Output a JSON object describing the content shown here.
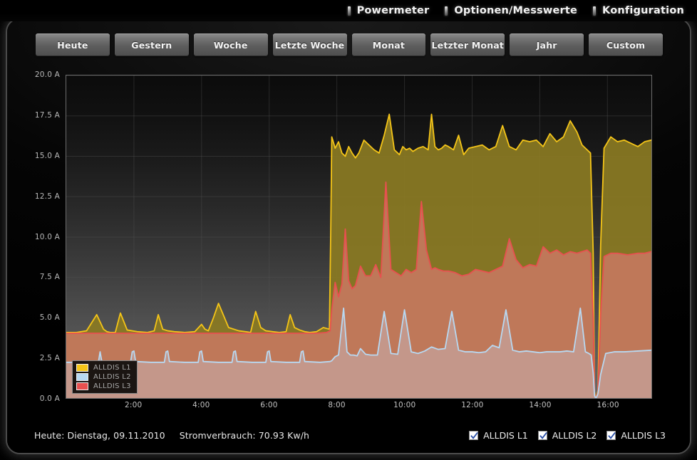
{
  "topnav": {
    "items": [
      {
        "label": "Powermeter",
        "icon": "bar-bullet-icon"
      },
      {
        "label": "Optionen/Messwerte",
        "icon": "bar-bullet-icon"
      },
      {
        "label": "Konfiguration",
        "icon": "bar-bullet-icon"
      }
    ]
  },
  "range_buttons": [
    {
      "label": "Heute",
      "active": true
    },
    {
      "label": "Gestern",
      "active": false
    },
    {
      "label": "Woche",
      "active": false
    },
    {
      "label": "Letzte Woche",
      "active": false
    },
    {
      "label": "Monat",
      "active": false
    },
    {
      "label": "Letzter Monat",
      "active": false
    },
    {
      "label": "Jahr",
      "active": false
    },
    {
      "label": "Custom",
      "active": false
    }
  ],
  "footer": {
    "date_text": "Heute: Dienstag, 09.11.2010",
    "consumption_text": "Stromverbrauch: 70.93 Kw/h",
    "checkboxes": [
      {
        "label": "ALLDIS L1",
        "checked": true
      },
      {
        "label": "ALLDIS L2",
        "checked": true
      },
      {
        "label": "ALLDIS L3",
        "checked": true
      }
    ]
  },
  "colors": {
    "l1": "#f5c518",
    "l2": "#b8d9f2",
    "l3": "#e8504f",
    "l1_fill": "#8a7a22",
    "l2_fill": "#c49a8e",
    "l3_fill": "#c4795e",
    "plot_border": "#6c6c6c",
    "grid": "#555555"
  },
  "chart_data": {
    "type": "area",
    "title": "",
    "xlabel": "",
    "ylabel": "A",
    "xlim": [
      0,
      17.3
    ],
    "ylim": [
      0,
      20
    ],
    "grid": true,
    "legend_position": "bottom-left",
    "y_ticks": [
      "0.0 A",
      "2.5 A",
      "5.0 A",
      "7.5 A",
      "10.0 A",
      "12.5 A",
      "15.0 A",
      "17.5 A",
      "20.0 A"
    ],
    "y_tick_values": [
      0,
      2.5,
      5,
      7.5,
      10,
      12.5,
      15,
      17.5,
      20
    ],
    "x_ticks": [
      "2:00",
      "4:00",
      "6:00",
      "8:00",
      "10:00",
      "12:00",
      "14:00",
      "16:00"
    ],
    "x_tick_values": [
      2,
      4,
      6,
      8,
      10,
      12,
      14,
      16
    ],
    "series": [
      {
        "name": "ALLDIS L1",
        "color": "#f5c518",
        "fill": "#8a7a22",
        "x": [
          0.0,
          0.3,
          0.6,
          0.9,
          1.1,
          1.2,
          1.3,
          1.45,
          1.6,
          1.8,
          2.1,
          2.4,
          2.6,
          2.72,
          2.85,
          3.0,
          3.2,
          3.5,
          3.8,
          4.0,
          4.1,
          4.2,
          4.35,
          4.5,
          4.8,
          5.1,
          5.3,
          5.45,
          5.6,
          5.75,
          5.9,
          6.1,
          6.3,
          6.5,
          6.62,
          6.75,
          6.9,
          7.05,
          7.2,
          7.4,
          7.6,
          7.78,
          7.82,
          7.85,
          7.88,
          7.95,
          8.05,
          8.15,
          8.25,
          8.35,
          8.45,
          8.55,
          8.65,
          8.8,
          8.95,
          9.1,
          9.25,
          9.4,
          9.55,
          9.7,
          9.85,
          9.95,
          10.05,
          10.15,
          10.25,
          10.4,
          10.55,
          10.7,
          10.8,
          10.9,
          11.0,
          11.1,
          11.2,
          11.3,
          11.45,
          11.6,
          11.75,
          11.9,
          12.1,
          12.3,
          12.5,
          12.7,
          12.9,
          13.1,
          13.3,
          13.5,
          13.7,
          13.9,
          14.1,
          14.3,
          14.5,
          14.7,
          14.9,
          15.1,
          15.25,
          15.4,
          15.5,
          15.58,
          15.62,
          15.66,
          15.72,
          15.8,
          15.9,
          16.1,
          16.3,
          16.5,
          16.7,
          16.9,
          17.1,
          17.3
        ],
        "y": [
          4.1,
          4.1,
          4.2,
          5.2,
          4.3,
          4.15,
          4.1,
          4.1,
          5.3,
          4.25,
          4.15,
          4.1,
          4.2,
          5.2,
          4.3,
          4.2,
          4.15,
          4.1,
          4.15,
          4.6,
          4.3,
          4.2,
          5.0,
          5.9,
          4.4,
          4.2,
          4.15,
          4.1,
          5.4,
          4.4,
          4.2,
          4.15,
          4.1,
          4.15,
          5.2,
          4.4,
          4.25,
          4.15,
          4.1,
          4.15,
          4.4,
          4.3,
          10.5,
          16.2,
          16.0,
          15.5,
          15.9,
          15.2,
          15.0,
          15.6,
          15.2,
          14.9,
          15.2,
          16.0,
          15.7,
          15.4,
          15.2,
          16.3,
          17.6,
          15.4,
          15.1,
          15.6,
          15.4,
          15.5,
          15.3,
          15.5,
          15.6,
          15.4,
          17.6,
          15.6,
          15.4,
          15.5,
          15.7,
          15.6,
          15.4,
          16.3,
          15.1,
          15.5,
          15.6,
          15.7,
          15.4,
          15.6,
          16.9,
          15.6,
          15.4,
          16.0,
          15.9,
          16.0,
          15.6,
          16.4,
          15.9,
          16.2,
          17.2,
          16.5,
          15.7,
          15.4,
          15.2,
          9.0,
          0.4,
          0.0,
          0.5,
          9.5,
          15.5,
          16.2,
          15.9,
          16.0,
          15.8,
          15.6,
          15.9,
          16.0
        ]
      },
      {
        "name": "ALLDIS L3",
        "color": "#e8504f",
        "fill": "#c4795e",
        "x": [
          0.0,
          0.5,
          1.0,
          1.5,
          2.0,
          2.5,
          3.0,
          3.5,
          4.0,
          4.5,
          5.0,
          5.5,
          6.0,
          6.5,
          7.0,
          7.4,
          7.7,
          7.8,
          7.85,
          7.95,
          8.05,
          8.15,
          8.25,
          8.35,
          8.45,
          8.55,
          8.7,
          8.85,
          9.0,
          9.15,
          9.3,
          9.45,
          9.6,
          9.75,
          9.9,
          10.05,
          10.2,
          10.35,
          10.5,
          10.65,
          10.8,
          10.9,
          11.0,
          11.15,
          11.3,
          11.5,
          11.7,
          11.9,
          12.1,
          12.3,
          12.5,
          12.7,
          12.9,
          13.1,
          13.3,
          13.5,
          13.7,
          13.9,
          14.1,
          14.3,
          14.5,
          14.7,
          14.9,
          15.1,
          15.25,
          15.4,
          15.5,
          15.58,
          15.62,
          15.66,
          15.72,
          15.8,
          15.9,
          16.1,
          16.3,
          16.6,
          16.9,
          17.1,
          17.3
        ],
        "y": [
          4.05,
          4.05,
          4.05,
          4.05,
          4.05,
          4.05,
          4.05,
          4.05,
          4.05,
          4.05,
          4.05,
          4.05,
          4.05,
          4.05,
          4.05,
          4.05,
          4.1,
          4.2,
          5.5,
          7.2,
          6.3,
          7.1,
          10.5,
          7.3,
          6.8,
          7.0,
          8.2,
          7.6,
          7.6,
          8.3,
          7.5,
          13.4,
          8.0,
          7.8,
          7.6,
          8.0,
          7.8,
          8.0,
          12.2,
          9.2,
          8.0,
          8.1,
          8.0,
          7.9,
          7.9,
          7.8,
          7.6,
          7.7,
          8.0,
          7.9,
          7.8,
          8.0,
          8.2,
          9.9,
          8.6,
          8.1,
          8.3,
          8.2,
          9.4,
          9.0,
          9.2,
          8.9,
          9.1,
          9.0,
          9.1,
          9.2,
          9.0,
          5.0,
          0.3,
          0.0,
          0.4,
          5.2,
          8.8,
          9.0,
          9.0,
          8.9,
          9.0,
          9.0,
          9.1
        ]
      },
      {
        "name": "ALLDIS L2",
        "color": "#b8d9f2",
        "fill": "#c49a8e",
        "x": [
          0.0,
          0.5,
          0.95,
          1.0,
          1.05,
          1.4,
          1.9,
          1.95,
          2.0,
          2.05,
          2.5,
          2.9,
          2.95,
          3.0,
          3.05,
          3.5,
          3.9,
          3.95,
          4.0,
          4.05,
          4.5,
          4.9,
          4.95,
          5.0,
          5.05,
          5.5,
          5.9,
          5.95,
          6.0,
          6.05,
          6.5,
          6.9,
          6.95,
          7.0,
          7.05,
          7.5,
          7.8,
          7.85,
          7.95,
          8.05,
          8.2,
          8.3,
          8.4,
          8.5,
          8.6,
          8.7,
          8.85,
          9.0,
          9.2,
          9.4,
          9.6,
          9.8,
          10.0,
          10.2,
          10.4,
          10.6,
          10.8,
          11.0,
          11.2,
          11.4,
          11.6,
          11.8,
          12.0,
          12.2,
          12.4,
          12.6,
          12.8,
          13.0,
          13.2,
          13.4,
          13.6,
          13.8,
          14.0,
          14.2,
          14.4,
          14.6,
          14.8,
          15.0,
          15.2,
          15.35,
          15.45,
          15.52,
          15.58,
          15.62,
          15.66,
          15.72,
          15.8,
          15.95,
          16.2,
          16.5,
          16.9,
          17.3
        ],
        "y": [
          2.25,
          2.25,
          2.25,
          2.9,
          2.3,
          2.25,
          2.25,
          2.9,
          2.95,
          2.3,
          2.25,
          2.25,
          2.9,
          2.95,
          2.3,
          2.25,
          2.25,
          2.9,
          2.95,
          2.3,
          2.25,
          2.25,
          2.9,
          2.95,
          2.3,
          2.25,
          2.25,
          2.9,
          2.95,
          2.3,
          2.25,
          2.25,
          2.9,
          2.95,
          2.3,
          2.25,
          2.3,
          2.35,
          2.6,
          2.7,
          5.6,
          2.9,
          2.7,
          2.7,
          2.65,
          3.1,
          2.75,
          2.7,
          2.7,
          5.4,
          2.8,
          2.75,
          5.5,
          2.9,
          2.8,
          2.95,
          3.2,
          3.05,
          3.1,
          5.4,
          3.0,
          2.9,
          2.9,
          2.85,
          2.9,
          3.3,
          3.15,
          5.5,
          3.0,
          2.9,
          2.95,
          2.9,
          2.85,
          2.9,
          2.9,
          2.9,
          2.95,
          2.9,
          5.6,
          2.9,
          2.8,
          2.7,
          1.6,
          0.2,
          0.0,
          0.3,
          1.5,
          2.8,
          2.9,
          2.9,
          2.95,
          3.0
        ]
      }
    ]
  }
}
